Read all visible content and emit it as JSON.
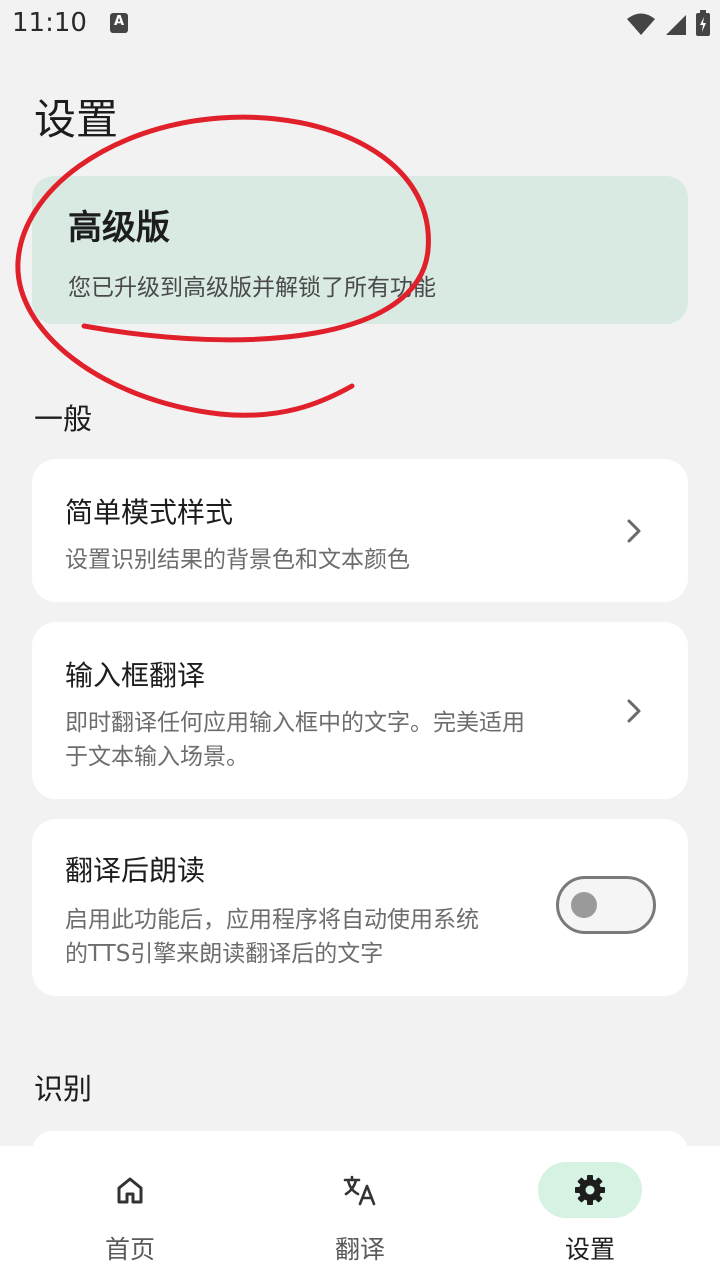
{
  "statusbar": {
    "time": "11:10",
    "notification_icon_letter": "A"
  },
  "page": {
    "title": "设置"
  },
  "premium": {
    "title": "高级版",
    "subtitle": "您已升级到高级版并解锁了所有功能"
  },
  "sections": {
    "general": "一般",
    "recognition": "识别"
  },
  "settings": {
    "simple_mode": {
      "title": "简单模式样式",
      "desc": "设置识别结果的背景色和文本颜色"
    },
    "input_translate": {
      "title": "输入框翻译",
      "desc_line1": "即时翻译任何应用输入框中的文字。完美适用",
      "desc_line2": "于文本输入场景。"
    },
    "read_aloud": {
      "title": "翻译后朗读",
      "desc_line1": "启用此功能后，应用程序将自动使用系统",
      "desc_line2": "的TTS引擎来朗读翻译后的文字",
      "enabled": false
    }
  },
  "nav": {
    "items": [
      {
        "label": "首页",
        "icon": "home-icon"
      },
      {
        "label": "翻译",
        "icon": "translate-icon"
      },
      {
        "label": "设置",
        "icon": "gear-icon",
        "active": true
      }
    ]
  },
  "colors": {
    "accent_bg": "#d8eae2",
    "nav_active_pill": "#d5f2e3",
    "annotation": "#e0202a"
  }
}
